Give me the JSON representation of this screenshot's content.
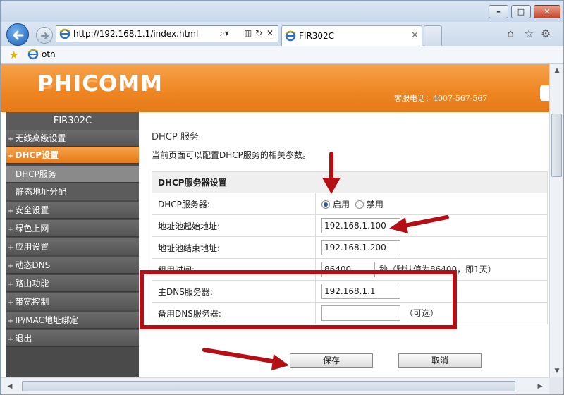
{
  "browser": {
    "address": "http://192.168.1.1/index.html",
    "tab_title": "FIR302C",
    "favorite_label": "otn",
    "colors": {
      "chrome": "#dde7f3",
      "back_button": "#1f5fb8"
    }
  },
  "router": {
    "logo": "PHICOMM",
    "hotline": "客服电话：4007-567-567",
    "model": "FIR302C",
    "colors": {
      "banner": "#ee8521",
      "sidebar": "#4a4a4a",
      "active": "#e57a18"
    }
  },
  "sidebar": {
    "items": [
      {
        "label": "无线高级设置",
        "prefix": "+"
      },
      {
        "label": "DHCP设置",
        "prefix": "+"
      },
      {
        "label": "DHCP服务"
      },
      {
        "label": "静态地址分配"
      },
      {
        "label": "安全设置",
        "prefix": "+"
      },
      {
        "label": "绿色上网",
        "prefix": "+"
      },
      {
        "label": "应用设置",
        "prefix": "+"
      },
      {
        "label": "动态DNS",
        "prefix": "+"
      },
      {
        "label": "路由功能",
        "prefix": "+"
      },
      {
        "label": "带宽控制",
        "prefix": "+"
      },
      {
        "label": "IP/MAC地址绑定",
        "prefix": "+"
      },
      {
        "label": "退出",
        "prefix": "+"
      }
    ]
  },
  "content": {
    "title": "DHCP 服务",
    "description": "当前页面可以配置DHCP服务的相关参数。",
    "section_header": "DHCP服务器设置",
    "dhcp_server_label": "DHCP服务器:",
    "enable_label": "启用",
    "disable_label": "禁用",
    "dhcp_enabled": true,
    "start_label": "地址池起始地址:",
    "start_value": "192.168.1.100",
    "end_label": "地址池结束地址:",
    "end_value": "192.168.1.200",
    "lease_label": "租用时间:",
    "lease_value": "86400",
    "lease_hint": "秒（默认值为86400，即1天）",
    "primary_dns_label": "主DNS服务器:",
    "primary_dns_value": "192.168.1.1",
    "secondary_dns_label": "备用DNS服务器:",
    "secondary_dns_value": "",
    "secondary_dns_hint": "（可选）",
    "save_label": "保存",
    "cancel_label": "取消"
  },
  "annotation_color": "#b30f14"
}
